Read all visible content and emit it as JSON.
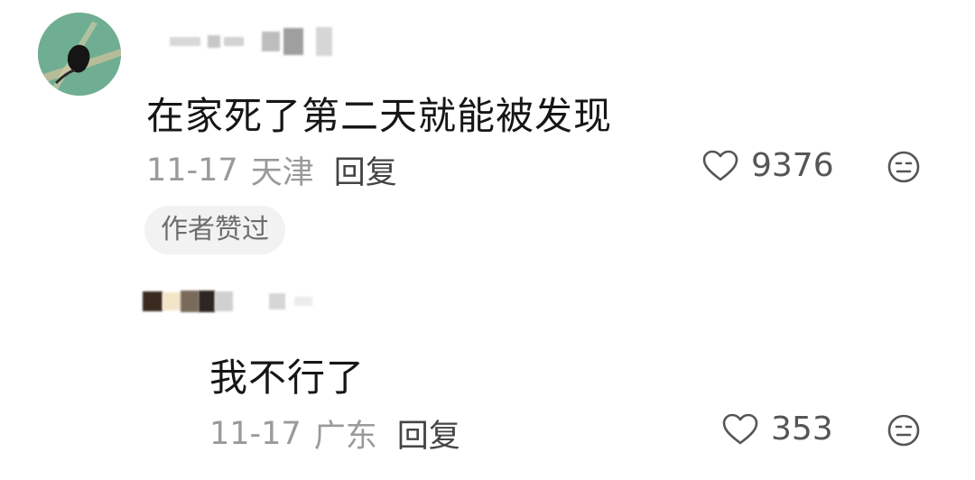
{
  "comments": [
    {
      "text": "在家死了第二天就能被发现",
      "date": "11-17",
      "location": "天津",
      "reply_label": "回复",
      "likes": "9376",
      "badge": "作者赞过"
    },
    {
      "text": "我不行了",
      "date": "11-17",
      "location": "广东",
      "reply_label": "回复",
      "likes": "353"
    }
  ],
  "icons": {
    "like": "heart-icon",
    "dislike": "dislike-face-icon"
  },
  "colors": {
    "text": "#161616",
    "meta": "#9a9a9a",
    "reply": "#444444",
    "badge_bg": "#f2f2f2",
    "avatar_green": "#6aa88c"
  }
}
